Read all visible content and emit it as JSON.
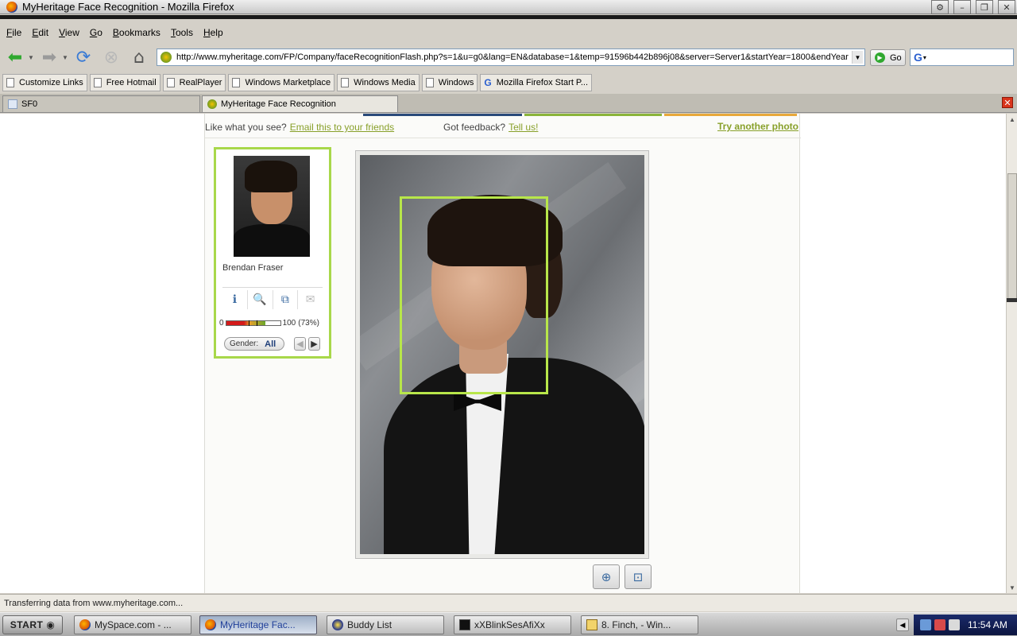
{
  "window": {
    "title": "MyHeritage Face Recognition - Mozilla Firefox"
  },
  "menu": [
    "File",
    "Edit",
    "View",
    "Go",
    "Bookmarks",
    "Tools",
    "Help"
  ],
  "nav": {
    "url": "http://www.myheritage.com/FP/Company/faceRecognitionFlash.php?s=1&u=g0&lang=EN&database=1&temp=91596b442b896j08&server=Server1&startYear=1800&endYear",
    "go_label": "Go"
  },
  "bookmarks": [
    "Customize Links",
    "Free Hotmail",
    "RealPlayer",
    "Windows Marketplace",
    "Windows Media",
    "Windows",
    "Mozilla Firefox Start P..."
  ],
  "tabs": [
    {
      "label": "SF0",
      "active": false
    },
    {
      "label": "MyHeritage Face Recognition",
      "active": true
    }
  ],
  "page": {
    "like_text": "Like what you see?",
    "email_link": "Email this to your friends",
    "feedback_text": "Got feedback?",
    "tell_us_link": "Tell us!",
    "try_another": "Try another photo",
    "stripe_colors": [
      "#2a4a7a",
      "#ffffff",
      "#8ab43a",
      "#ffffff",
      "#e8a83a"
    ]
  },
  "match": {
    "name": "Brendan Fraser",
    "score_min": "0",
    "score_max": "100",
    "score_pct_label": "(73%)",
    "score_fraction": 0.73,
    "gender_label": "Gender:",
    "gender_value": "All",
    "icons": [
      "info-icon",
      "search-icon",
      "compare-icon",
      "email-icon"
    ]
  },
  "status": {
    "text": "Transferring data from www.myheritage.com..."
  },
  "taskbar": {
    "start": "START",
    "tasks": [
      {
        "label": "MySpace.com - ...",
        "icon": "firefox-icon",
        "active": false
      },
      {
        "label": "MyHeritage Fac...",
        "icon": "firefox-icon",
        "active": true
      },
      {
        "label": "Buddy List",
        "icon": "aim-icon",
        "active": false
      },
      {
        "label": "xXBlinkSesAfiXx",
        "icon": "window-icon",
        "active": false
      },
      {
        "label": "8. Finch, - Win...",
        "icon": "media-icon",
        "active": false
      }
    ],
    "clock": "11:54 AM"
  },
  "colors": {
    "accent_green": "#88a02a",
    "face_box": "#b8e64a",
    "card_border": "#a8d84a"
  }
}
